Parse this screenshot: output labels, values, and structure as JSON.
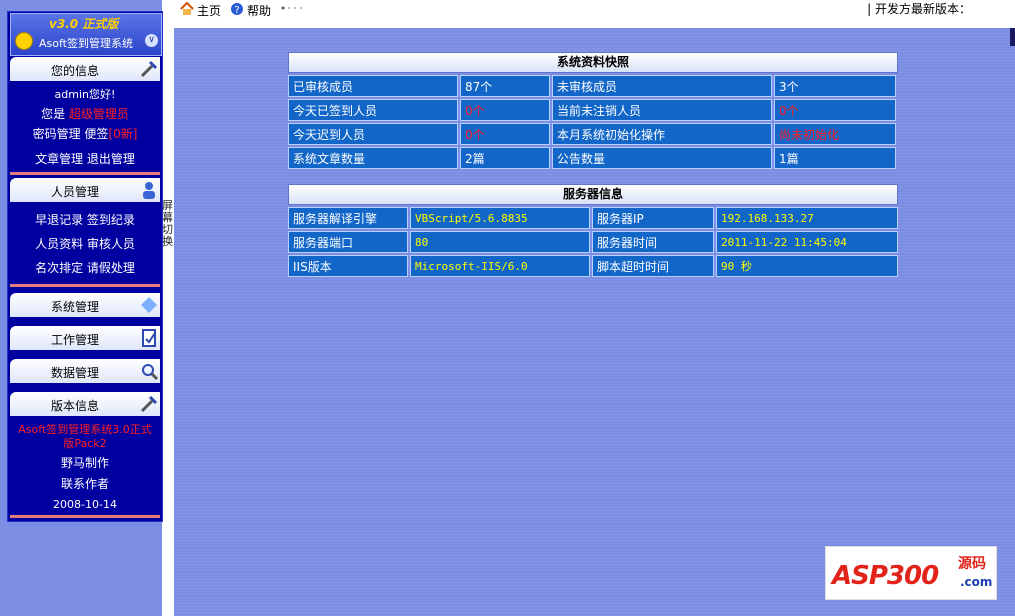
{
  "logo": {
    "version": "v3.0 正式版",
    "name": "Asoft签到管理系统"
  },
  "sidebar": {
    "your_info": {
      "title": "您的信息",
      "greeting": "admin您好!",
      "role_prefix": "您是",
      "role": "超级管理员",
      "password_manage": "密码管理",
      "memo": "便签",
      "memo_count": "[0新]",
      "article_manage": "文章管理",
      "logout": "退出管理"
    },
    "staff": {
      "title": "人员管理",
      "items": [
        "早退记录",
        "签到纪录",
        "人员资料",
        "审核人员",
        "名次排定",
        "请假处理"
      ]
    },
    "system": {
      "title": "系统管理"
    },
    "work": {
      "title": "工作管理"
    },
    "data": {
      "title": "数据管理"
    },
    "version": {
      "title": "版本信息",
      "product_line1": "Asoft签到管理系统3.0正式",
      "product_line2": "版Pack2",
      "author": "野马制作",
      "contact": "联系作者",
      "date": "2008-10-14"
    }
  },
  "screen_switch": [
    "屏",
    "幕",
    "切",
    "换"
  ],
  "topbar": {
    "home": "主页",
    "help": "帮助",
    "dev_latest": "| 开发方最新版本："
  },
  "snapshot": {
    "title": "系统资料快照",
    "rows": [
      [
        "已审核成员",
        "87个",
        "未审核成员",
        "3个"
      ],
      [
        "今天已签到人员",
        "0个",
        "当前未注销人员",
        "0个"
      ],
      [
        "今天迟到人员",
        "0个",
        "本月系统初始化操作",
        "尚未初始化"
      ],
      [
        "系统文章数量",
        "2篇",
        "公告数量",
        "1篇"
      ]
    ]
  },
  "server": {
    "title": "服务器信息",
    "rows": [
      [
        "服务器解译引擎",
        "VBScript/5.6.8835",
        "服务器IP",
        "192.168.133.27"
      ],
      [
        "服务器端口",
        "80",
        "服务器时间",
        "2011-11-22 11:45:04"
      ],
      [
        "IIS版本",
        "Microsoft-IIS/6.0",
        "脚本超时时间",
        "90 秒"
      ]
    ]
  },
  "watermark": {
    "main": "ASP300",
    "side": "源码",
    "domain": ".com"
  },
  "colors": {
    "sidebar_bg": "#0000a0",
    "main_bg": "#7b8ee4",
    "cell_bg": "#1266c8",
    "alert_red": "#ff2020",
    "mono_value": "#ffff00"
  }
}
